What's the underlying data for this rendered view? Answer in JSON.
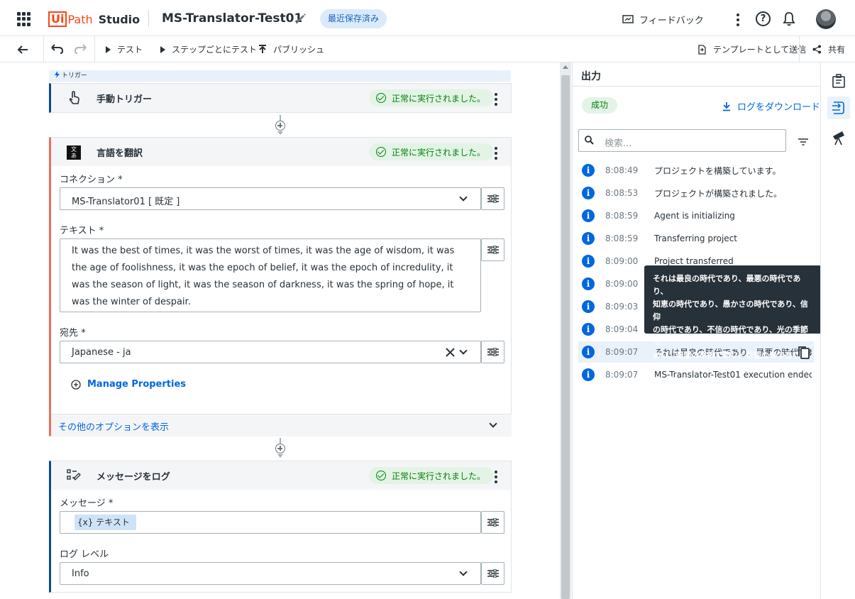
{
  "app": {
    "brand_ui": "Ui",
    "brand_path": "Path",
    "brand_studio": "Studio",
    "project_name": "MS-Translator-Test01",
    "saved_status": "最近保存済み",
    "feedback_label": "フィードバック",
    "help_glyph": "?"
  },
  "toolbar": {
    "test_label": "テスト",
    "step_test_label": "ステップごとにテスト",
    "publish_label": "パブリッシュ",
    "template_send_label": "テンプレートとして送信",
    "share_label": "共有"
  },
  "workflow": {
    "trigger_strip_label": "トリガー",
    "manual_trigger": {
      "title": "手動トリガー",
      "status": "正常に実行されました。"
    },
    "translate": {
      "title": "言語を翻訳",
      "status": "正常に実行されました。",
      "connection_label": "コネクション *",
      "connection_value": "MS-Translator01 [ 既定 ]",
      "text_label": "テキスト *",
      "text_lines": [
        "It was the best of times, it was the worst of times, it was the age of wisdom, it was",
        "the age of foolishness, it was the epoch of belief, it was the epoch of incredulity, it",
        "was the season of light, it was the season of darkness, it was the spring of hope, it",
        "was the winter of despair."
      ],
      "dest_label": "宛先 *",
      "dest_value": "Japanese - ja",
      "manage_properties": "Manage Properties",
      "more_options": "その他のオプションを表示"
    },
    "log_message": {
      "title": "メッセージをログ",
      "status": "正常に実行されました。",
      "message_label": "メッセージ *",
      "message_chip": "{x} テキスト",
      "level_label": "ログ レベル",
      "level_value": "Info"
    }
  },
  "output": {
    "title": "出力",
    "result": "成功",
    "download_label": "ログをダウンロード",
    "search_placeholder": "検索...",
    "logs": [
      {
        "time": "8:08:49",
        "msg": "プロジェクトを構築しています。"
      },
      {
        "time": "8:08:53",
        "msg": "プロジェクトが構築されました。"
      },
      {
        "time": "8:08:59",
        "msg": "Agent is initializing"
      },
      {
        "time": "8:08:59",
        "msg": "Transferring project"
      },
      {
        "time": "8:09:00",
        "msg": "Project transferred"
      },
      {
        "time": "8:09:00",
        "msg": ""
      },
      {
        "time": "8:09:03",
        "msg": ""
      },
      {
        "time": "8:09:04",
        "msg": ""
      },
      {
        "time": "8:09:07",
        "msg": "それは最良の時代であり、最悪の時代であ"
      },
      {
        "time": "8:09:07",
        "msg": "MS-Translator-Test01 execution ended"
      }
    ],
    "tooltip_lines": [
      "それは最良の時代であり、最悪の時代であり、",
      "知恵の時代であり、愚かさの時代であり、信仰",
      "の時代であり、不信の時代であり、光の季節で",
      "あり、暗闇の季節であり、希望の春であり、絶",
      "望の冬であった。"
    ]
  },
  "colors": {
    "brand": "#fa4616",
    "accent_blue": "#0067df",
    "success_green": "#038108",
    "card_stripe_blue": "#0b4a8f",
    "card_stripe_orange": "#e8705a"
  }
}
